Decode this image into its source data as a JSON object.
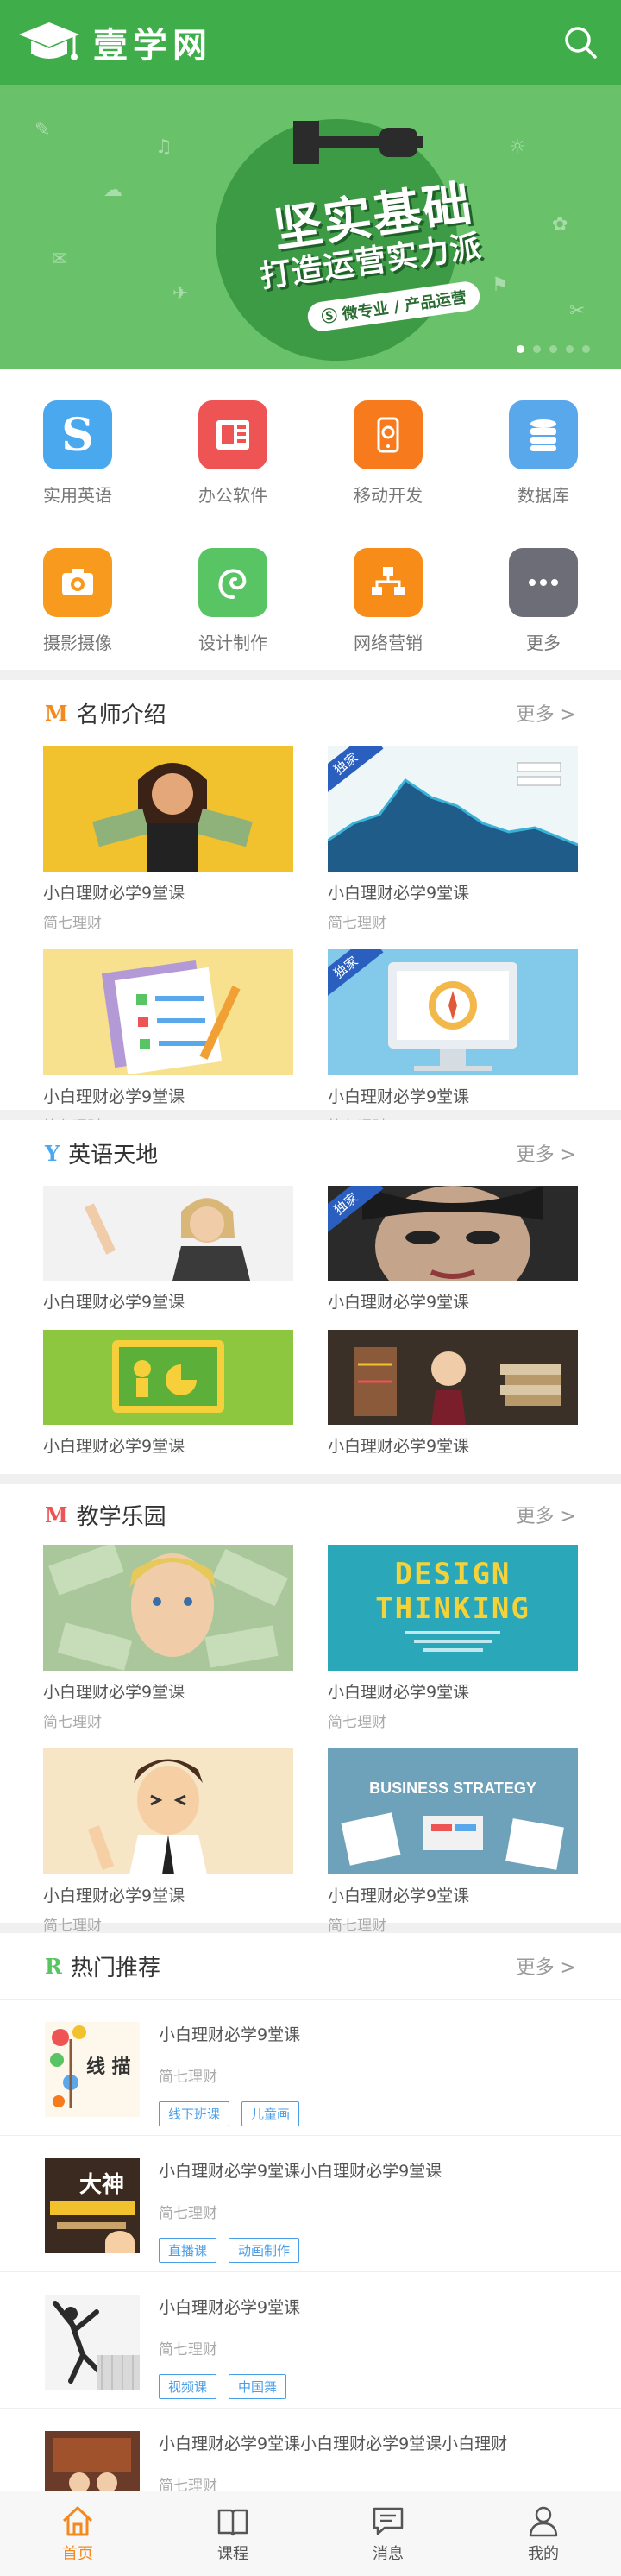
{
  "header": {
    "logo_text": "壹学网"
  },
  "banner": {
    "title": "坚实基础",
    "subtitle": "打造运营实力派",
    "tag": "微专业 / 产品运营",
    "dot_count": 5,
    "active_dot": 0
  },
  "categories": [
    {
      "label": "实用英语",
      "color": "#4aa8ef",
      "icon": "s-letter-icon"
    },
    {
      "label": "办公软件",
      "color": "#ee5454",
      "icon": "powerpoint-icon"
    },
    {
      "label": "移动开发",
      "color": "#f77a1c",
      "icon": "mobile-dev-icon"
    },
    {
      "label": "数据库",
      "color": "#5aa8ec",
      "icon": "database-icon"
    },
    {
      "label": "摄影摄像",
      "color": "#f89a1e",
      "icon": "camera-icon"
    },
    {
      "label": "设计制作",
      "color": "#58c463",
      "icon": "swirl-icon"
    },
    {
      "label": "网络营销",
      "color": "#f78c19",
      "icon": "network-icon"
    },
    {
      "label": "更多",
      "color": "#6d6d78",
      "icon": "more-dots-icon"
    }
  ],
  "teachers": {
    "mark": "M",
    "title": "名师介绍",
    "more": "更多 >",
    "cards": [
      {
        "title": "小白理财必学9堂课",
        "sub": "简七理财",
        "badge": ""
      },
      {
        "title": "小白理财必学9堂课",
        "sub": "简七理财",
        "badge": "独家"
      },
      {
        "title": "小白理财必学9堂课",
        "sub": "简七理财",
        "badge": ""
      },
      {
        "title": "小白理财必学9堂课",
        "sub": "简七理财",
        "badge": "独家"
      }
    ]
  },
  "english": {
    "mark": "Y",
    "title": "英语天地",
    "more": "更多 >",
    "cards": [
      {
        "title": "小白理财必学9堂课",
        "badge": ""
      },
      {
        "title": "小白理财必学9堂课",
        "badge": "独家"
      },
      {
        "title": "小白理财必学9堂课",
        "badge": ""
      },
      {
        "title": "小白理财必学9堂课",
        "badge": ""
      }
    ]
  },
  "fun": {
    "mark": "M",
    "title": "教学乐园",
    "more": "更多 >",
    "cards": [
      {
        "title": "小白理财必学9堂课",
        "sub": "简七理财"
      },
      {
        "title": "小白理财必学9堂课",
        "sub": "简七理财",
        "thumb_text": "DESIGN THINKING"
      },
      {
        "title": "小白理财必学9堂课",
        "sub": "简七理财"
      },
      {
        "title": "小白理财必学9堂课",
        "sub": "简七理财",
        "thumb_text": "BUSINESS STRATEGY"
      }
    ]
  },
  "hot": {
    "mark": "R",
    "title": "热门推荐",
    "more": "更多 >",
    "items": [
      {
        "title": "小白理财必学9堂课",
        "sub": "简七理财",
        "tags": [
          "线下班课",
          "儿童画"
        ],
        "thumb_text": "线 描"
      },
      {
        "title": "小白理财必学9堂课小白理财必学9堂课",
        "sub": "简七理财",
        "tags": [
          "直播课",
          "动画制作"
        ],
        "thumb_text": "大神"
      },
      {
        "title": "小白理财必学9堂课",
        "sub": "简七理财",
        "tags": [
          "视频课",
          "中国舞"
        ],
        "thumb_text": ""
      },
      {
        "title": "小白理财必学9堂课小白理财必学9堂课小白理财",
        "sub": "简七理财",
        "tags": [],
        "thumb_text": ""
      }
    ]
  },
  "bottom_nav": [
    {
      "label": "首页",
      "icon": "home-icon",
      "active": true
    },
    {
      "label": "课程",
      "icon": "book-icon",
      "active": false
    },
    {
      "label": "消息",
      "icon": "message-icon",
      "active": false
    },
    {
      "label": "我的",
      "icon": "user-icon",
      "active": false
    }
  ]
}
